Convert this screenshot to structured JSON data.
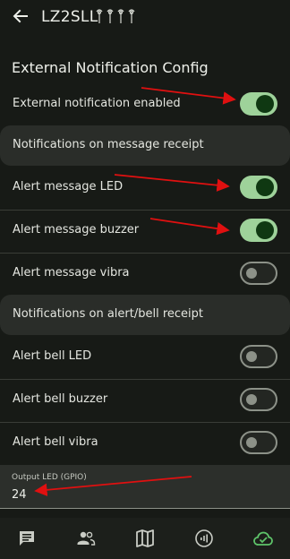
{
  "header": {
    "title": "LZ2SLL"
  },
  "section_title": "External Notification Config",
  "rows": {
    "ext_enabled": {
      "label": "External notification enabled",
      "on": true
    },
    "msg_led": {
      "label": "Alert message LED",
      "on": true
    },
    "msg_buzzer": {
      "label": "Alert message buzzer",
      "on": true
    },
    "msg_vibra": {
      "label": "Alert message vibra",
      "on": false
    },
    "bell_led": {
      "label": "Alert bell LED",
      "on": false
    },
    "bell_buzzer": {
      "label": "Alert bell buzzer",
      "on": false
    },
    "bell_vibra": {
      "label": "Alert bell vibra",
      "on": false
    }
  },
  "groups": {
    "message": "Notifications on message receipt",
    "bell": "Notifications on alert/bell receipt"
  },
  "output_led": {
    "label": "Output LED (GPIO)",
    "value": "24"
  },
  "nav": [
    "chat-icon",
    "people-icon",
    "map-icon",
    "signal-icon",
    "cloud-check-icon"
  ],
  "colors": {
    "background": "#171a16",
    "switch_on_track": "#9ed29a",
    "switch_on_knob": "#0f3812",
    "switch_off": "#8c9188",
    "nav_active": "#5ec46a",
    "annotation_arrow": "#e01010"
  }
}
